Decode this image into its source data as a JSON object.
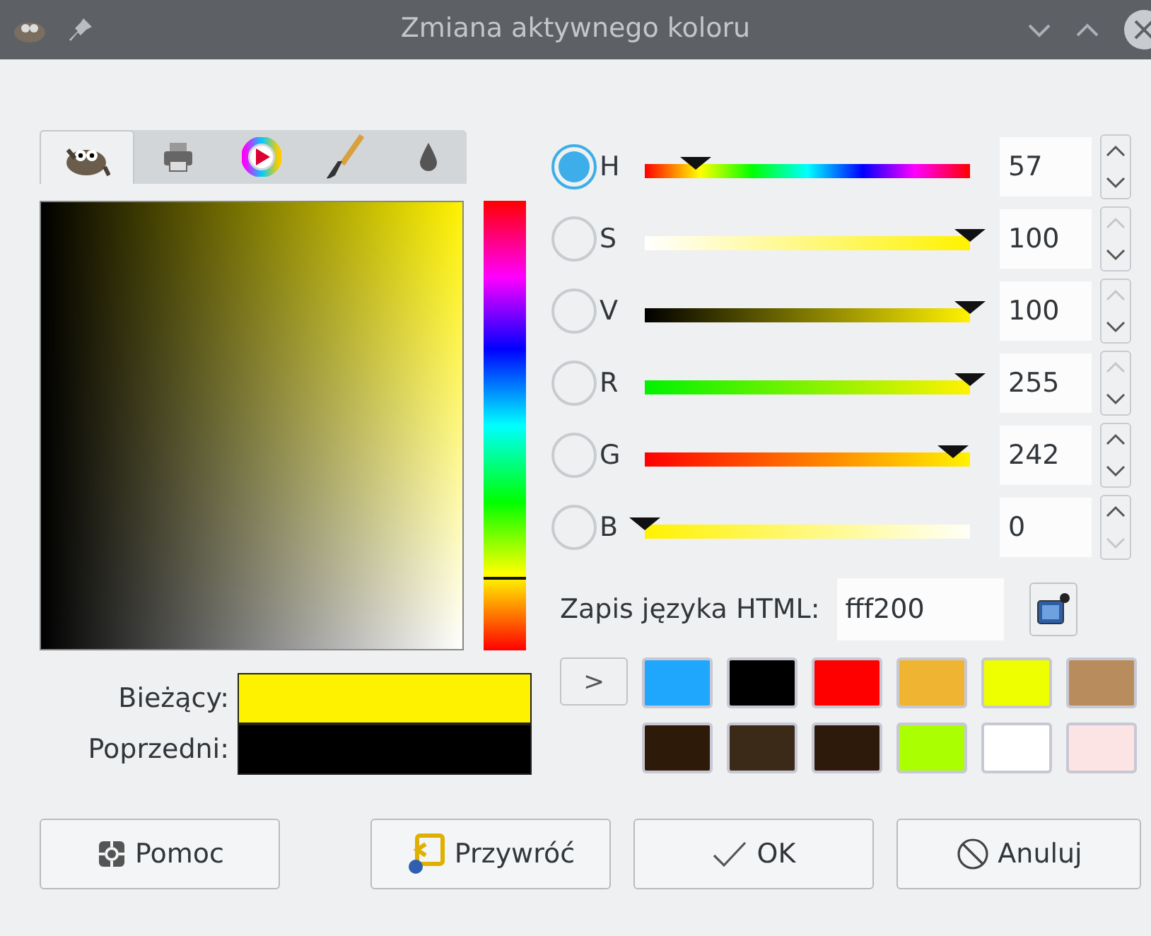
{
  "window": {
    "title": "Zmiana aktywnego koloru"
  },
  "tabs": [
    {
      "selected": true
    },
    {
      "selected": false
    },
    {
      "selected": false
    },
    {
      "selected": false
    },
    {
      "selected": false
    }
  ],
  "channels": [
    {
      "kind": "hue",
      "label": "H",
      "selected": true,
      "level": 0.158,
      "value": "57",
      "up_disabled": false,
      "down_disabled": false
    },
    {
      "kind": "saturation",
      "label": "S",
      "selected": false,
      "level": 1,
      "value": "100",
      "up_disabled": true,
      "down_disabled": false
    },
    {
      "kind": "value",
      "label": "V",
      "selected": false,
      "level": 1,
      "value": "100",
      "up_disabled": true,
      "down_disabled": false
    },
    {
      "kind": "red",
      "label": "R",
      "selected": false,
      "level": 1,
      "value": "255",
      "up_disabled": true,
      "down_disabled": false
    },
    {
      "kind": "green",
      "label": "G",
      "selected": false,
      "level": 0.949,
      "value": "242",
      "up_disabled": false,
      "down_disabled": false
    },
    {
      "kind": "blue",
      "label": "B",
      "selected": false,
      "level": 0,
      "value": "0",
      "up_disabled": false,
      "down_disabled": true
    }
  ],
  "html_notation": {
    "label": "Zapis języka HTML:",
    "value": "fff200"
  },
  "expand_button": {
    "label": ">"
  },
  "history": [
    {
      "color": "#1ea7fd"
    },
    {
      "color": "#000000"
    },
    {
      "color": "#ff0000"
    },
    {
      "color": "#f0b433"
    },
    {
      "color": "#eeff00"
    },
    {
      "color": "#b88c5c"
    },
    {
      "color": "#2e1a08"
    },
    {
      "color": "#3c2a18"
    },
    {
      "color": "#2e1a0a"
    },
    {
      "color": "#aaff00"
    },
    {
      "color": "#ffffff"
    },
    {
      "color": "#fde4e4"
    }
  ],
  "current": {
    "label": "Bieżący:",
    "color": "#fff200"
  },
  "previous": {
    "label": "Poprzedni:",
    "color": "#000000"
  },
  "buttons": [
    {
      "kind": "help",
      "label": "Pomoc"
    },
    {
      "kind": "reset",
      "label": "Przywróć"
    },
    {
      "kind": "ok",
      "label": "OK"
    },
    {
      "kind": "cancel",
      "label": "Anuluj"
    }
  ]
}
